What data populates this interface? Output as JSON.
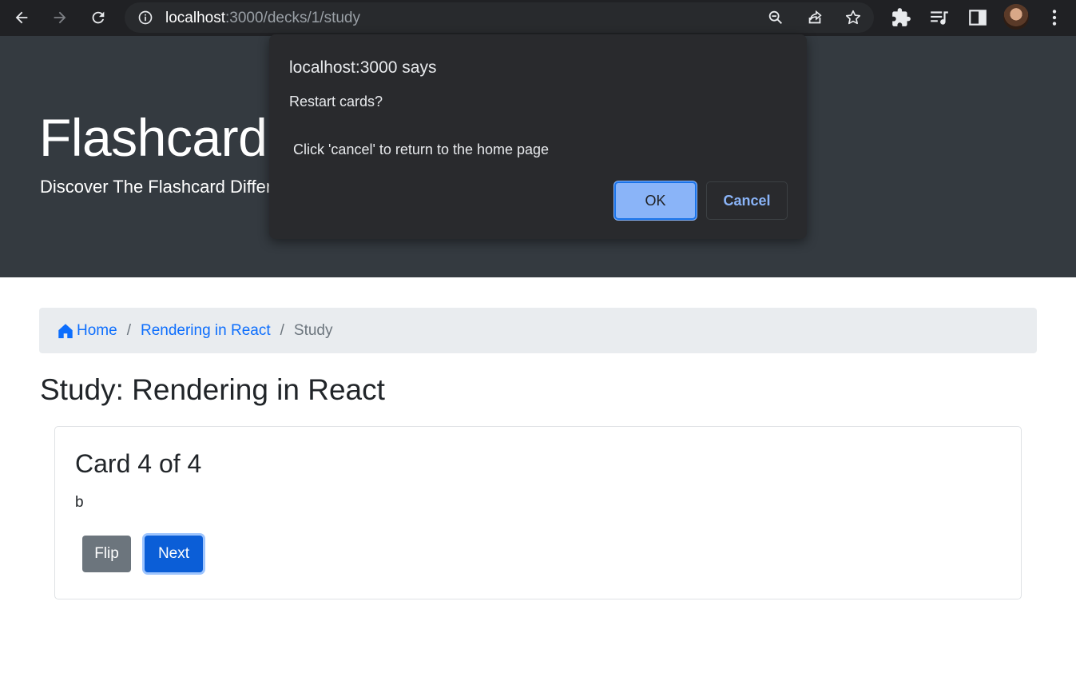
{
  "browser": {
    "url_host": "localhost",
    "url_path": ":3000/decks/1/study",
    "icons": [
      "back-arrow-icon",
      "forward-arrow-icon",
      "reload-icon",
      "info-icon",
      "zoom-icon",
      "share-icon",
      "star-icon",
      "extensions-icon",
      "media-queue-icon",
      "side-panel-icon",
      "kebab-menu-icon"
    ]
  },
  "jumbotron": {
    "title": "Flashcard-o-matic",
    "subtitle": "Discover The Flashcard Difference."
  },
  "breadcrumb": {
    "home": "Home",
    "deck": "Rendering in React",
    "current": "Study",
    "separator": "/"
  },
  "study": {
    "title": "Study: Rendering in React"
  },
  "card": {
    "title": "Card 4 of 4",
    "text": "b",
    "flip_label": "Flip",
    "next_label": "Next"
  },
  "dialog": {
    "origin": "localhost:3000 says",
    "message_line1": "Restart cards?",
    "message_line2": "Click 'cancel' to return to the home page",
    "ok_label": "OK",
    "cancel_label": "Cancel"
  },
  "colors": {
    "chrome_bg": "#202124",
    "jumbotron_bg": "#343a40",
    "link": "#0d6efd",
    "primary": "#0b5ed7",
    "secondary": "#6c757d",
    "dialog_bg": "#292a2d",
    "dialog_accent": "#8ab4f8"
  }
}
